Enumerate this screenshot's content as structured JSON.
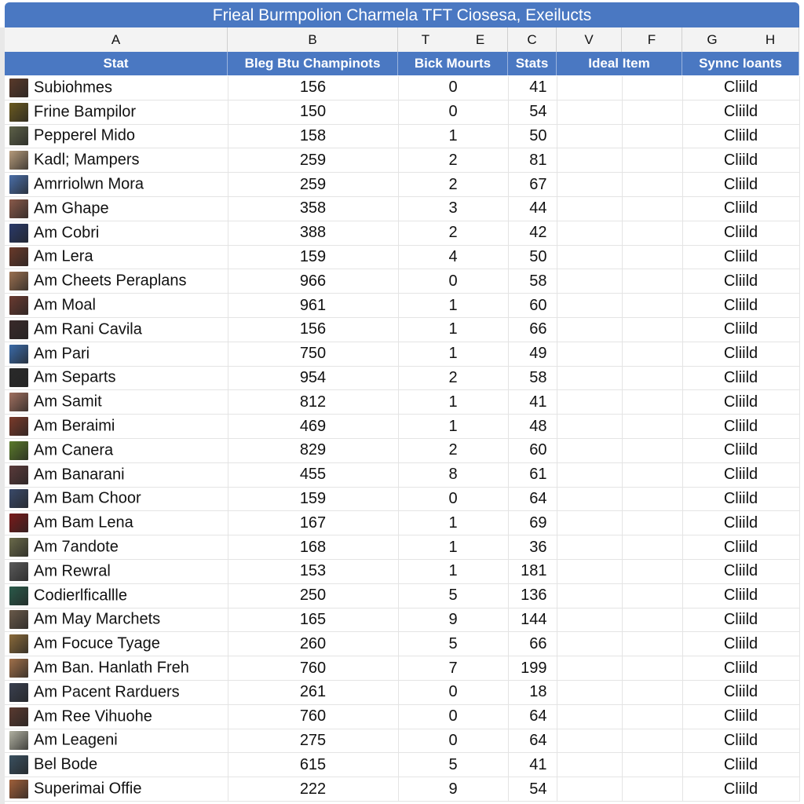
{
  "title": "Frieal Burmpolion Charmela TFT Ciosesa, Exeilucts",
  "column_letters": [
    "A",
    "B",
    "T",
    "E",
    "C",
    "V",
    "F",
    "G",
    "H"
  ],
  "headers": [
    "Stat",
    "Bleg Btu Champinots",
    "Bick Mourts",
    "Stats",
    "Ideal Item",
    "Synnc Ioants"
  ],
  "rows": [
    {
      "name": "Subiohmes",
      "b": "156",
      "e": "0",
      "c": "41",
      "h": "Cliild",
      "avatar_color": "#5a3a2a"
    },
    {
      "name": "Frine Bampilor",
      "b": "150",
      "e": "0",
      "c": "54",
      "h": "Cliild",
      "avatar_color": "#6b5a20"
    },
    {
      "name": "Pepperel Mido",
      "b": "158",
      "e": "1",
      "c": "50",
      "h": "Cliild",
      "avatar_color": "#5d6148"
    },
    {
      "name": "Kadl; Mampers",
      "b": "259",
      "e": "2",
      "c": "81",
      "h": "Cliild",
      "avatar_color": "#b59a7a"
    },
    {
      "name": "Amrriolwn Mora",
      "b": "259",
      "e": "2",
      "c": "67",
      "h": "Cliild",
      "avatar_color": "#4a6ea8"
    },
    {
      "name": "Am Ghape",
      "b": "358",
      "e": "3",
      "c": "44",
      "h": "Cliild",
      "avatar_color": "#8a5a4a"
    },
    {
      "name": "Am Cobri",
      "b": "388",
      "e": "2",
      "c": "42",
      "h": "Cliild",
      "avatar_color": "#2a3a6a"
    },
    {
      "name": "Am Lera",
      "b": "159",
      "e": "4",
      "c": "50",
      "h": "Cliild",
      "avatar_color": "#6a3a2a"
    },
    {
      "name": "Am Cheets Peraplans",
      "b": "966",
      "e": "0",
      "c": "58",
      "h": "Cliild",
      "avatar_color": "#9a7050"
    },
    {
      "name": "Am Moal",
      "b": "961",
      "e": "1",
      "c": "60",
      "h": "Cliild",
      "avatar_color": "#6a3a30"
    },
    {
      "name": "Am Rani Cavila",
      "b": "156",
      "e": "1",
      "c": "66",
      "h": "Cliild",
      "avatar_color": "#3a2a2a"
    },
    {
      "name": "Am Pari",
      "b": "750",
      "e": "1",
      "c": "49",
      "h": "Cliild",
      "avatar_color": "#3a6aa8"
    },
    {
      "name": "Am Separts",
      "b": "954",
      "e": "2",
      "c": "58",
      "h": "Cliild",
      "avatar_color": "#2a2a2a"
    },
    {
      "name": "Am Samit",
      "b": "812",
      "e": "1",
      "c": "41",
      "h": "Cliild",
      "avatar_color": "#a07060"
    },
    {
      "name": "Am Beraimi",
      "b": "469",
      "e": "1",
      "c": "48",
      "h": "Cliild",
      "avatar_color": "#7a3a2a"
    },
    {
      "name": "Am Canera",
      "b": "829",
      "e": "2",
      "c": "60",
      "h": "Cliild",
      "avatar_color": "#5a7a2a"
    },
    {
      "name": "Am Banarani",
      "b": "455",
      "e": "8",
      "c": "61",
      "h": "Cliild",
      "avatar_color": "#5a3a3a"
    },
    {
      "name": "Am Bam Choor",
      "b": "159",
      "e": "0",
      "c": "64",
      "h": "Cliild",
      "avatar_color": "#3a4a6a"
    },
    {
      "name": "Am Bam Lena",
      "b": "167",
      "e": "1",
      "c": "69",
      "h": "Cliild",
      "avatar_color": "#7a1a1a"
    },
    {
      "name": "Am 7andote",
      "b": "168",
      "e": "1",
      "c": "36",
      "h": "Cliild",
      "avatar_color": "#6a6a4a"
    },
    {
      "name": "Am Rewral",
      "b": "153",
      "e": "1",
      "c": "181",
      "h": "Cliild",
      "avatar_color": "#5a5a5a"
    },
    {
      "name": "Codierlficallle",
      "b": "250",
      "e": "5",
      "c": "136",
      "h": "Cliild",
      "avatar_color": "#2a5a4a"
    },
    {
      "name": "Am May Marchets",
      "b": "165",
      "e": "9",
      "c": "144",
      "h": "Cliild",
      "avatar_color": "#6a5a4a"
    },
    {
      "name": "Am Focuce Tyage",
      "b": "260",
      "e": "5",
      "c": "66",
      "h": "Cliild",
      "avatar_color": "#8a6a3a"
    },
    {
      "name": "Am Ban. Hanlath Freh",
      "b": "760",
      "e": "7",
      "c": "199",
      "h": "Cliild",
      "avatar_color": "#a0704a"
    },
    {
      "name": "Am Pacent Rarduers",
      "b": "261",
      "e": "0",
      "c": "18",
      "h": "Cliild",
      "avatar_color": "#3a4050"
    },
    {
      "name": "Am Ree Vihuohe",
      "b": "760",
      "e": "0",
      "c": "64",
      "h": "Cliild",
      "avatar_color": "#5a3a30"
    },
    {
      "name": "Am Leageni",
      "b": "275",
      "e": "0",
      "c": "64",
      "h": "Cliild",
      "avatar_color": "#b0b0a0"
    },
    {
      "name": "Bel Bode",
      "b": "615",
      "e": "5",
      "c": "41",
      "h": "Cliild",
      "avatar_color": "#3a5060"
    },
    {
      "name": "Superimai Offie",
      "b": "222",
      "e": "9",
      "c": "54",
      "h": "Cliild",
      "avatar_color": "#a0603a"
    }
  ]
}
